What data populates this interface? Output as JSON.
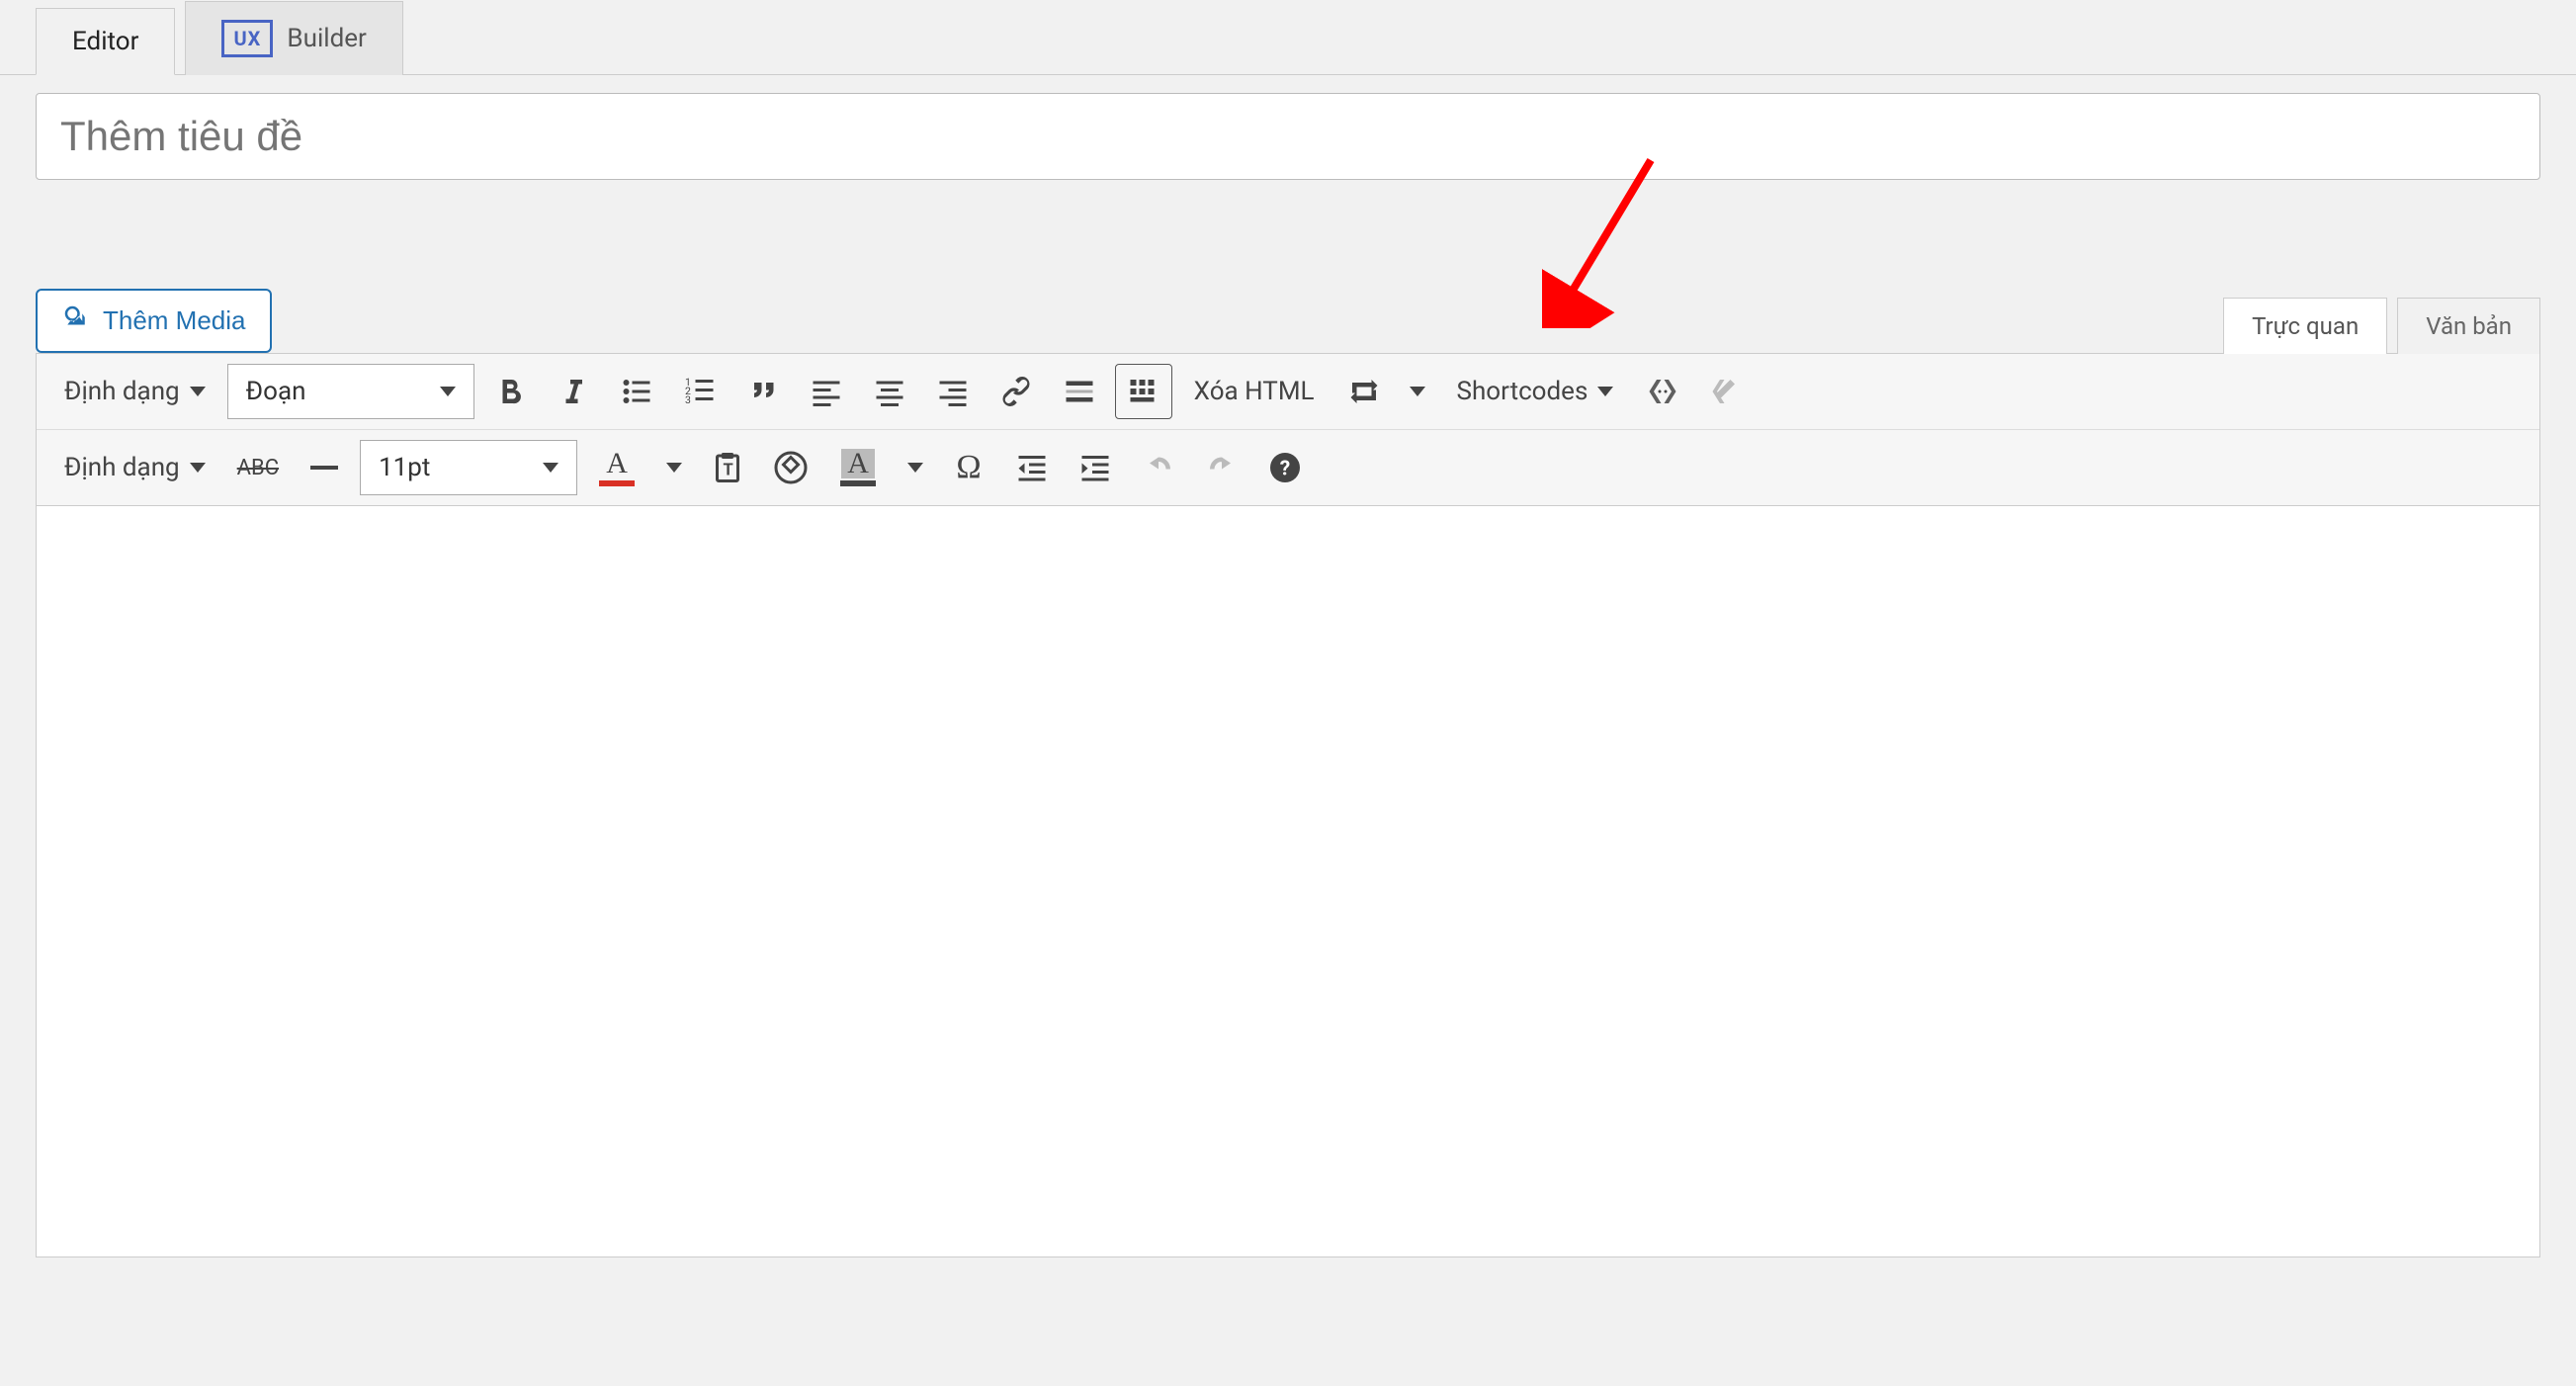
{
  "tabs": {
    "editor": "Editor",
    "builder": "Builder",
    "ux_badge": "UX"
  },
  "title": {
    "placeholder": "Thêm tiêu đề"
  },
  "media_button": "Thêm Media",
  "mode_tabs": {
    "visual": "Trực quan",
    "text": "Văn bản"
  },
  "toolbar": {
    "format_label": "Định dạng",
    "paragraph_select": "Đoạn",
    "clear_html": "Xóa HTML",
    "shortcodes": "Shortcodes",
    "font_size": "11pt"
  }
}
